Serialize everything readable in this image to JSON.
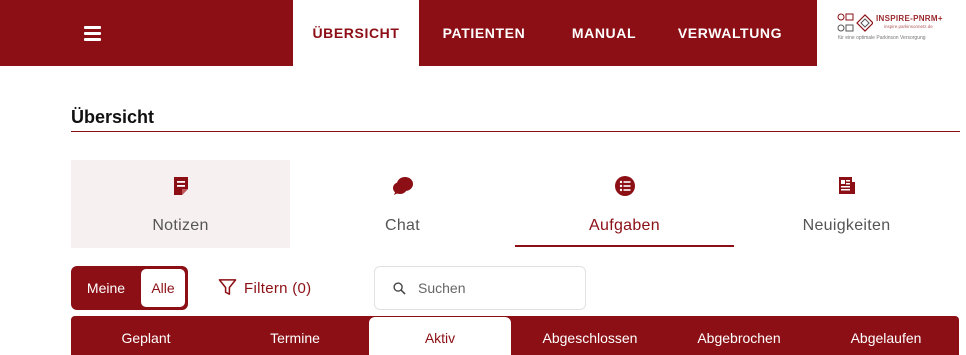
{
  "header": {
    "menu_icon": "hamburger-menu-icon",
    "nav": [
      {
        "label": "ÜBERSICHT",
        "active": true
      },
      {
        "label": "PATIENTEN",
        "active": false
      },
      {
        "label": "MANUAL",
        "active": false
      },
      {
        "label": "VERWALTUNG",
        "active": false
      }
    ],
    "brand": {
      "title": "INSPIRE-PNRM+",
      "url": "inspire.parkinsonnetz.de",
      "tagline": "für eine optimale Parkinson Versorgung",
      "logo_icon": "network-logo-icon"
    }
  },
  "page": {
    "title": "Übersicht"
  },
  "sections": [
    {
      "label": "Notizen",
      "icon": "notes-icon",
      "highlighted": true
    },
    {
      "label": "Chat",
      "icon": "chat-bubbles-icon"
    },
    {
      "label": "Aufgaben",
      "icon": "list-circle-icon",
      "selected": true
    },
    {
      "label": "Neuigkeiten",
      "icon": "newspaper-icon"
    }
  ],
  "toolbar": {
    "scope_options": [
      "Meine",
      "Alle"
    ],
    "scope_selected": "Alle",
    "filter_label": "Filtern (0)",
    "filter_icon": "funnel-icon",
    "search_placeholder": "Suchen",
    "search_value": "",
    "search_icon": "magnifier-icon"
  },
  "status_tabs": [
    {
      "label": "Geplant"
    },
    {
      "label": "Termine"
    },
    {
      "label": "Aktiv",
      "active": true
    },
    {
      "label": "Abgeschlossen"
    },
    {
      "label": "Abgebrochen"
    },
    {
      "label": "Abgelaufen"
    }
  ],
  "colors": {
    "primary": "#8b0f14",
    "tile_highlight": "#f6f1f0",
    "text_muted": "#555555"
  }
}
